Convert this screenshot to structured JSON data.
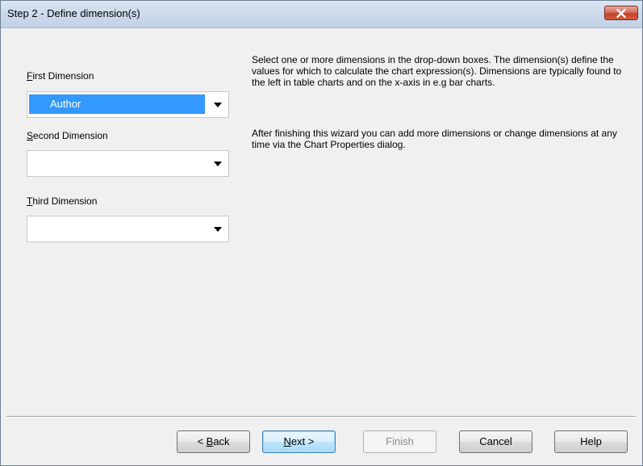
{
  "window": {
    "title": "Step 2 - Define dimension(s)"
  },
  "dimensions": [
    {
      "label_access": "F",
      "label_rest": "irst Dimension",
      "value": "Author"
    },
    {
      "label_access": "S",
      "label_rest": "econd Dimension",
      "value": ""
    },
    {
      "label_access": "T",
      "label_rest": "hird Dimension",
      "value": ""
    }
  ],
  "description": {
    "para1": "Select one or more dimensions in the drop-down boxes. The dimension(s) define the values for which to calculate the chart expression(s). Dimensions are typically found to the left in table charts and on the x-axis in e.g bar charts.",
    "para2": "After finishing this wizard you can add more dimensions or change dimensions at any time via the Chart Properties dialog."
  },
  "buttons": {
    "back_prefix": "< ",
    "back_access": "B",
    "back_rest": "ack",
    "next_access": "N",
    "next_rest": "ext >",
    "finish": "Finish",
    "cancel": "Cancel",
    "help": "Help"
  },
  "icons": {
    "close": "close-icon",
    "dropdown": "chevron-down-icon"
  },
  "colors": {
    "selection": "#3399ff",
    "close_button": "#c2442b"
  }
}
